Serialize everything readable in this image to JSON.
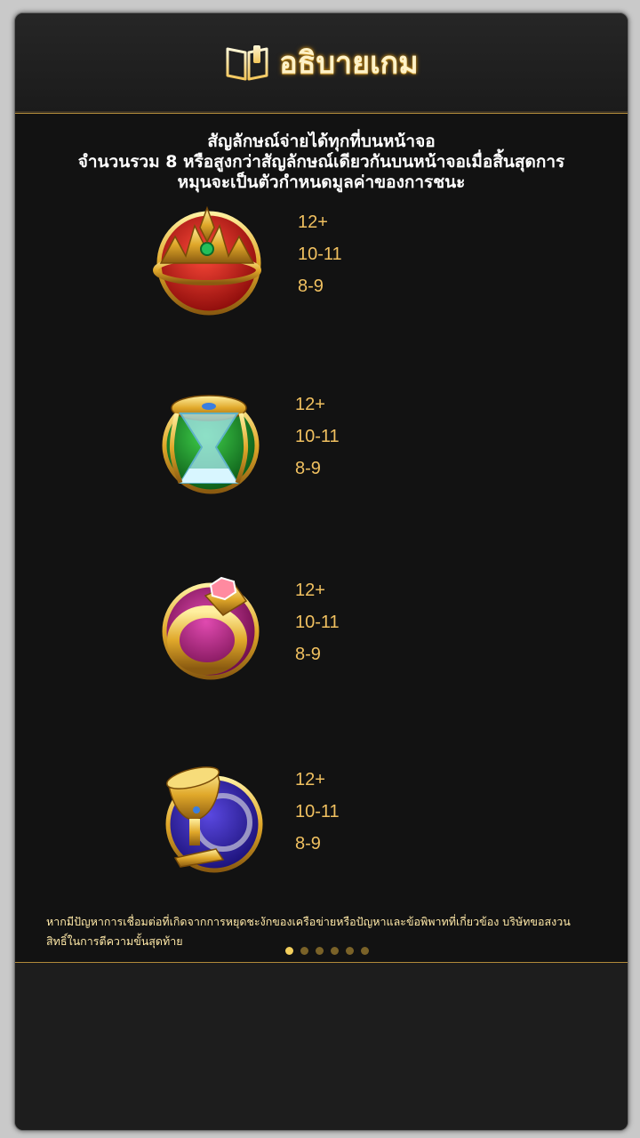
{
  "header": {
    "title": "อธิบายเกม",
    "icon": "book-icon"
  },
  "intro": {
    "line1": "สัญลักษณ์จ่ายได้ทุกที่บนหน้าจอ",
    "line2": "จำนวนรวม 8 หรือสูงกว่าสัญลักษณ์เดียวกันบนหน้าจอเมื่อสิ้นสุดการ",
    "line3": "หมุนจะเป็นตัวกำหนดมูลค่าของการชนะ"
  },
  "symbols": [
    {
      "name": "crown",
      "icon": "crown-icon",
      "bg": "#c8241f",
      "pays": [
        "12+",
        "10-11",
        "8-9"
      ]
    },
    {
      "name": "hourglass",
      "icon": "hourglass-icon",
      "bg": "#1f8a2b",
      "pays": [
        "12+",
        "10-11",
        "8-9"
      ]
    },
    {
      "name": "ring",
      "icon": "ring-icon",
      "bg": "#b0227a",
      "pays": [
        "12+",
        "10-11",
        "8-9"
      ]
    },
    {
      "name": "chalice",
      "icon": "chalice-icon",
      "bg": "#3a2aa8",
      "pays": [
        "12+",
        "10-11",
        "8-9"
      ]
    }
  ],
  "notice": {
    "line1": "หากมีปัญหาการเชื่อมต่อที่เกิดจากการหยุดชะงักของเครือข่ายหรือปัญหาและข้อพิพาทที่เกี่ยวข้อง บริษัทขอสงวน",
    "line2": "สิทธิ์ในการตีความขั้นสุดท้าย"
  },
  "pagination": {
    "total": 6,
    "current": 1
  }
}
